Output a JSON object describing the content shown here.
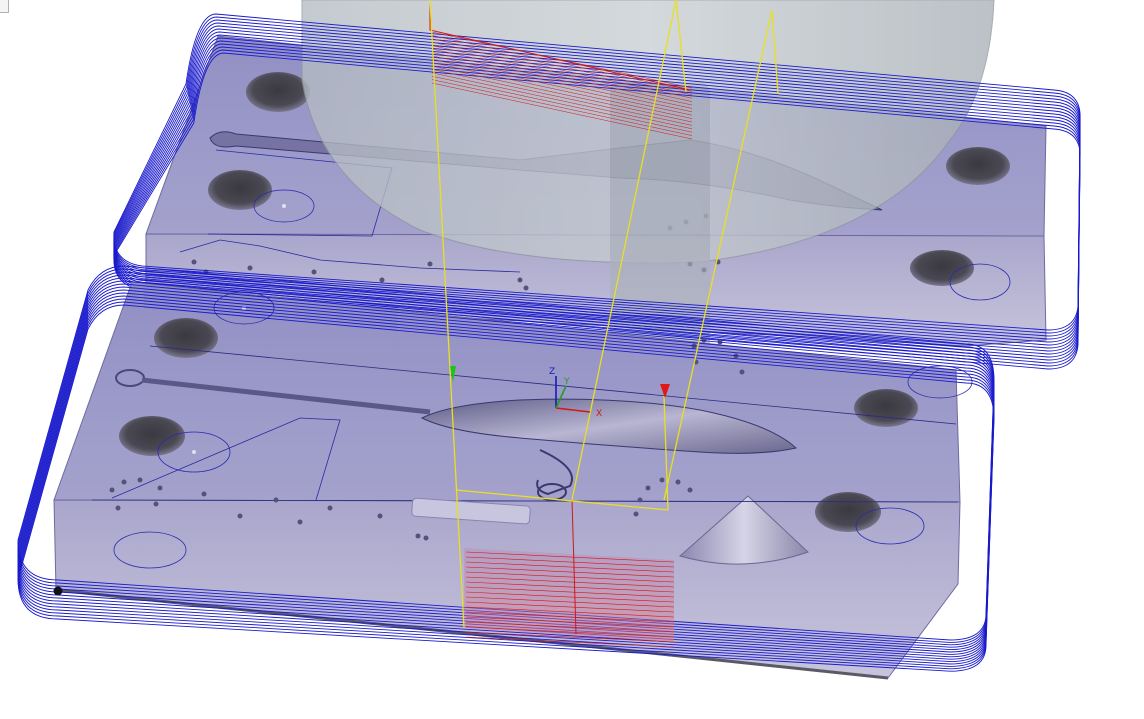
{
  "viewport": {
    "background": "#ffffff",
    "colors": {
      "toolpath": "#1a1acc",
      "stock": "#9a96c4",
      "tool_holder": "#a8b0b8",
      "tool_path_yellow": "#e8e020",
      "cut_red": "#d01818",
      "edges": "#2a2a80"
    }
  },
  "triad": {
    "z_label": "Z",
    "y_label": "Y",
    "x_label": "X"
  }
}
